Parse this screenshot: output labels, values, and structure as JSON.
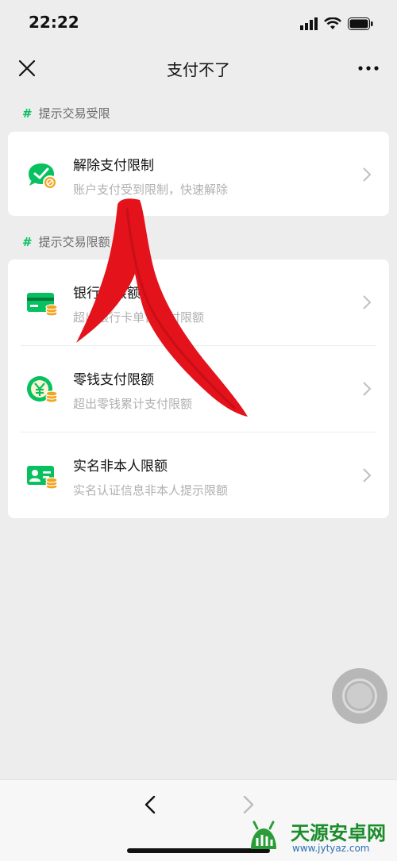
{
  "status_bar": {
    "time": "22:22"
  },
  "nav": {
    "title": "支付不了"
  },
  "sections": [
    {
      "heading": "提示交易受限",
      "items": [
        {
          "title": "解除支付限制",
          "subtitle": "账户支付受到限制，快速解除"
        }
      ]
    },
    {
      "heading": "提示交易限额",
      "items": [
        {
          "title": "银行卡限额",
          "subtitle": "超出银行卡单日支付限额"
        },
        {
          "title": "零钱支付限额",
          "subtitle": "超出零钱累计支付限额"
        },
        {
          "title": "实名非本人限额",
          "subtitle": "实名认证信息非本人提示限额"
        }
      ]
    }
  ],
  "watermark": {
    "name": "天源安卓网",
    "url": "www.jytyaz.com"
  },
  "colors": {
    "accent": "#07c160",
    "annotation": "#e3121b",
    "background": "#ededed"
  }
}
